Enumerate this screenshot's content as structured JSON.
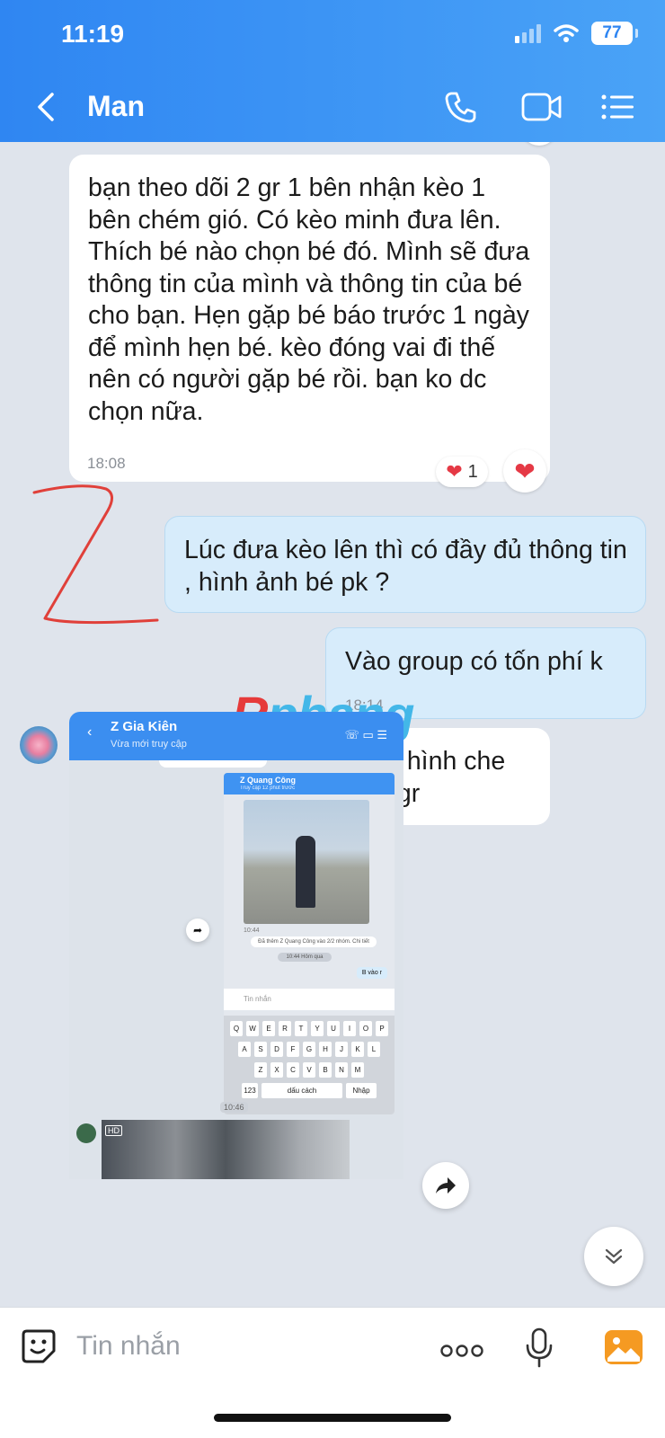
{
  "status": {
    "time": "11:19",
    "battery": "77"
  },
  "header": {
    "title": "Man"
  },
  "messages": [
    {
      "dir": "in",
      "text": "bạn theo dõi 2 gr 1 bên nhận kèo 1 bên chém gió. Có kèo minh đưa lên. Thích bé nào chọn bé đó. Mình sẽ đưa thông tin của mình và thông tin của bé cho bạn. Hẹn gặp bé báo trước 1 ngày để mình hẹn bé.  kèo đóng vai đi thế nên có người gặp bé rồi. bạn ko dc chọn nữa.",
      "time": "18:08",
      "reaction_count": "1"
    },
    {
      "dir": "out",
      "text": "Lúc đưa kèo lên thì có đầy đủ thông tin , hình ảnh bé pk ?"
    },
    {
      "dir": "out",
      "text": "Vào group có tốn phí k",
      "time": "18:14"
    },
    {
      "dir": "in",
      "text": "1 yêu cầu cuối. m xin 1 tấm hình che mặt của bạn. như ae trong gr"
    }
  ],
  "embedded": {
    "title": "Z Gia Kiên",
    "subtitle": "Vừa mới truy cập",
    "inner_title": "Z Quang Công",
    "inner_subtitle": "Truy cập 12 phút trước",
    "inner_time": "10:44",
    "system_msg": "Đã thêm Z Quang Công vào 2/2 nhóm. Chi tiết",
    "inner_time2": "10:44 Hôm qua",
    "inner_reply": "B vào r",
    "inner_placeholder": "Tin nhắn",
    "kb_row1": [
      "Q",
      "W",
      "E",
      "R",
      "T",
      "Y",
      "U",
      "I",
      "O",
      "P"
    ],
    "kb_row2": [
      "A",
      "S",
      "D",
      "F",
      "G",
      "H",
      "J",
      "K",
      "L"
    ],
    "kb_row3": [
      "Z",
      "X",
      "C",
      "V",
      "B",
      "N",
      "M"
    ],
    "kb_space": "dấu cách",
    "kb_enter": "Nhập",
    "kb_num": "123",
    "shot_time": "10:46",
    "hd_label": "HD"
  },
  "input": {
    "placeholder": "Tin nhắn"
  },
  "watermark": {
    "first": "R",
    "rest": "phang"
  },
  "colors": {
    "header": "#2f86f2",
    "incoming": "#ffffff",
    "outgoing": "#d7ecfb",
    "annotation": "#e0403a"
  },
  "icons": [
    "back-icon",
    "phone-icon",
    "video-icon",
    "menu-icon",
    "sticker-icon",
    "more-icon",
    "mic-icon",
    "gallery-icon",
    "forward-icon",
    "scroll-down-icon",
    "heart-icon"
  ]
}
